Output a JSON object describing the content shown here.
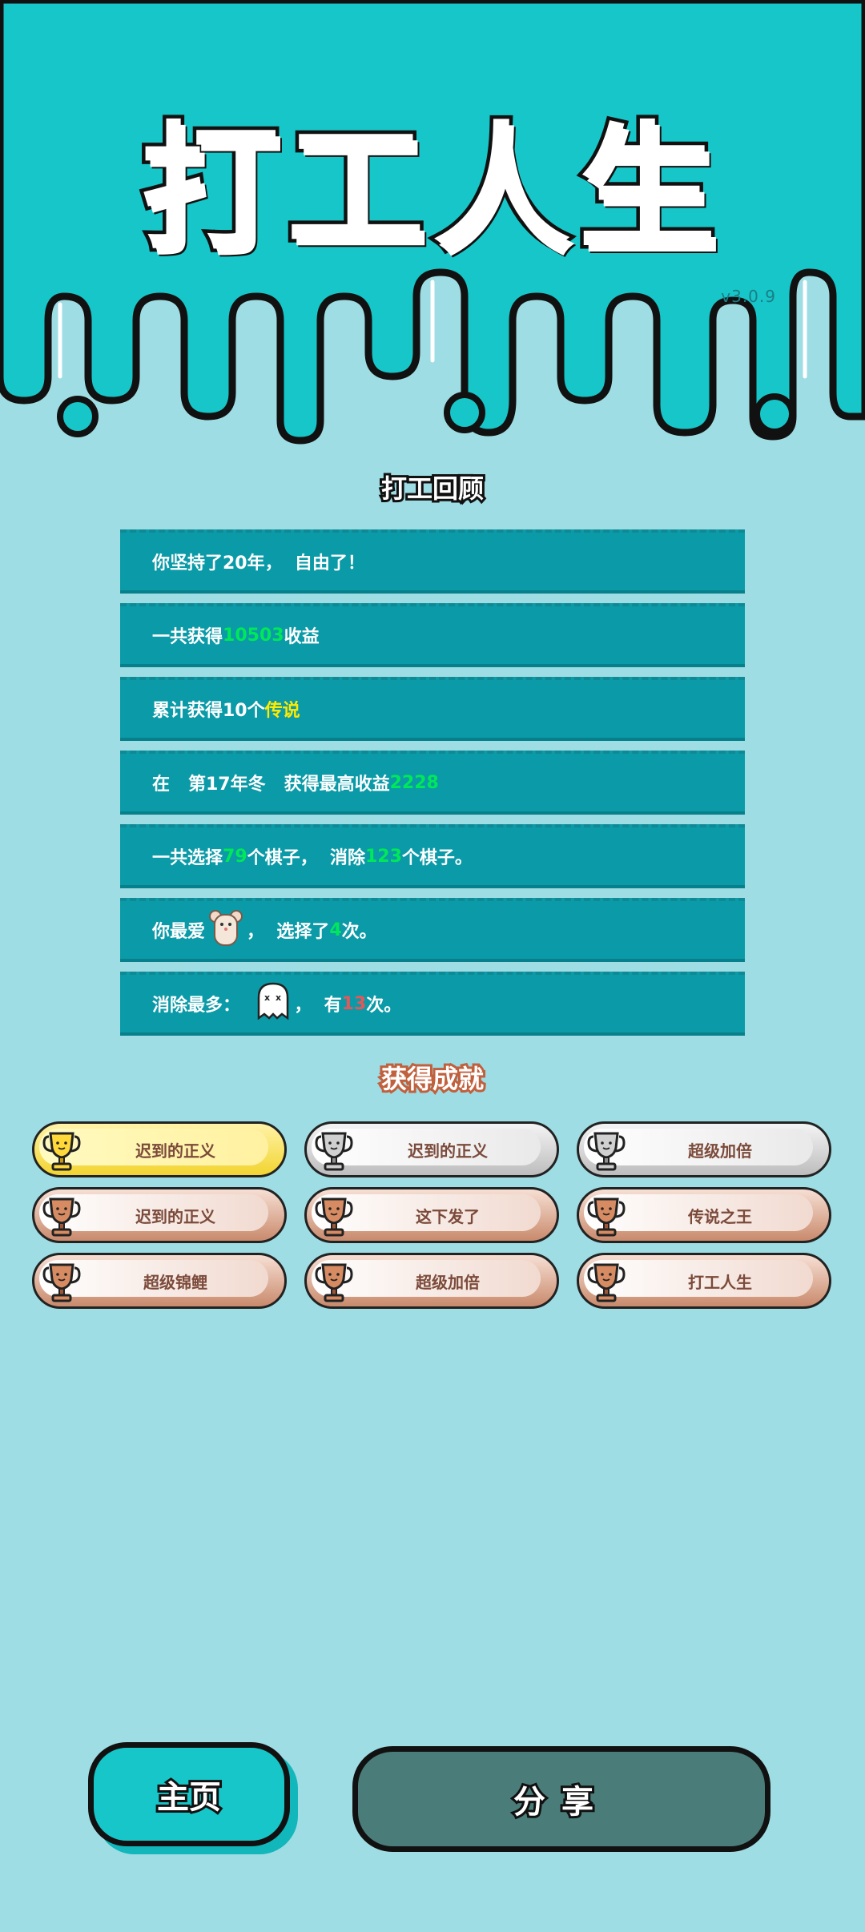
{
  "header": {
    "title": "打工人生",
    "version": "v3.0.9"
  },
  "review": {
    "title": "打工回顾",
    "rows": [
      {
        "parts": [
          {
            "text": "你坚持了20年，  自由了！"
          }
        ]
      },
      {
        "parts": [
          {
            "text": "一共获得"
          },
          {
            "text": "10503",
            "color": "green"
          },
          {
            "text": "收益"
          }
        ]
      },
      {
        "parts": [
          {
            "text": "累计获得10个"
          },
          {
            "text": "传说",
            "color": "yellow"
          }
        ]
      },
      {
        "parts": [
          {
            "text": "在   第17年冬   获得最高收益"
          },
          {
            "text": "2228",
            "color": "green"
          }
        ]
      },
      {
        "parts": [
          {
            "text": "一共选择"
          },
          {
            "text": "79",
            "color": "green"
          },
          {
            "text": "个棋子，  消除"
          },
          {
            "text": "123",
            "color": "green"
          },
          {
            "text": "个棋子。"
          }
        ]
      },
      {
        "parts": [
          {
            "text": "你最爱"
          },
          {
            "icon": "mouse-icon"
          },
          {
            "text": "，  选择了"
          },
          {
            "text": "4",
            "color": "green"
          },
          {
            "text": "次。"
          }
        ]
      },
      {
        "parts": [
          {
            "text": "消除最多：  "
          },
          {
            "icon": "ghost-icon"
          },
          {
            "text": "，  有"
          },
          {
            "text": "13",
            "color": "red"
          },
          {
            "text": "次。"
          }
        ]
      }
    ]
  },
  "achievements": {
    "title": "获得成就",
    "items": [
      {
        "label": "迟到的正义",
        "tier": "gold"
      },
      {
        "label": "迟到的正义",
        "tier": "silver"
      },
      {
        "label": "超级加倍",
        "tier": "silver"
      },
      {
        "label": "迟到的正义",
        "tier": "bronze"
      },
      {
        "label": "这下发了",
        "tier": "bronze"
      },
      {
        "label": "传说之王",
        "tier": "bronze"
      },
      {
        "label": "超级锦鲤",
        "tier": "bronze"
      },
      {
        "label": "超级加倍",
        "tier": "bronze"
      },
      {
        "label": "打工人生",
        "tier": "bronze"
      }
    ]
  },
  "buttons": {
    "home": "主页",
    "share": "分享"
  },
  "colors": {
    "accent": "#16c6c8",
    "green": "#00e85a",
    "yellow": "#ffea00",
    "red": "#e4575a"
  }
}
